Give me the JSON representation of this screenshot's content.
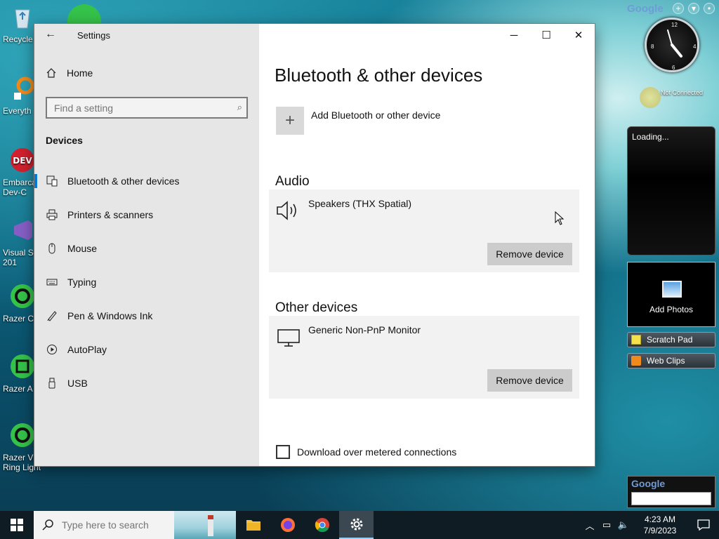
{
  "desktop": {
    "icons": [
      {
        "label": "Recycle"
      },
      {
        "label": "Everyth"
      },
      {
        "label": "Embarca Dev-C"
      },
      {
        "label": "Visual S 201"
      },
      {
        "label": "Razer C"
      },
      {
        "label": "Razer A"
      },
      {
        "label": "Razer Vi Ring Light"
      }
    ]
  },
  "window": {
    "title": "Settings",
    "controls": {
      "minimize": "─",
      "maximize": "☐",
      "close": "✕"
    },
    "back_glyph": "←"
  },
  "sidebar": {
    "home_label": "Home",
    "search_placeholder": "Find a setting",
    "section_label": "Devices",
    "items": [
      {
        "label": "Bluetooth & other devices",
        "icon": "bluetooth-keyboard-icon"
      },
      {
        "label": "Printers & scanners",
        "icon": "printer-icon"
      },
      {
        "label": "Mouse",
        "icon": "mouse-icon"
      },
      {
        "label": "Typing",
        "icon": "keyboard-icon"
      },
      {
        "label": "Pen & Windows Ink",
        "icon": "pen-icon"
      },
      {
        "label": "AutoPlay",
        "icon": "autoplay-icon"
      },
      {
        "label": "USB",
        "icon": "usb-icon"
      }
    ]
  },
  "content": {
    "title": "Bluetooth & other devices",
    "add_label": "Add Bluetooth or other device",
    "audio_title": "Audio",
    "audio_device": "Speakers (THX Spatial)",
    "other_title": "Other devices",
    "other_device": "Generic Non-PnP Monitor",
    "remove_label": "Remove device",
    "metered_label": "Download over metered connections"
  },
  "gadgets": {
    "google_top": "Google",
    "not_connected": "Not Connected",
    "loading": "Loading...",
    "add_photos": "Add Photos",
    "scratch_pad": "Scratch Pad",
    "web_clips": "Web Clips",
    "google_search": "Google"
  },
  "taskbar": {
    "search_placeholder": "Type here to search",
    "time": "4:23 AM",
    "date": "7/9/2023"
  },
  "colors": {
    "accent": "#0078d7",
    "sidebar_bg": "#e6e6e6",
    "card_bg": "#f2f2f2",
    "taskbar_bg": "#101c24"
  }
}
